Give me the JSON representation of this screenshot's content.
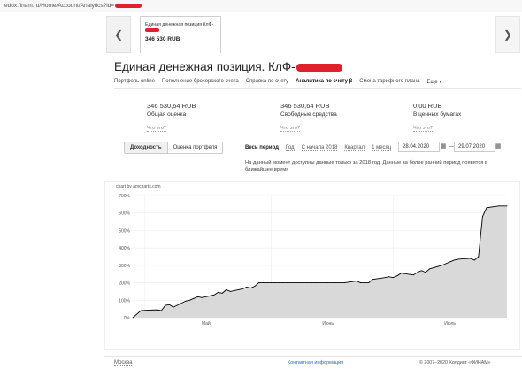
{
  "browser": {
    "url": "edox.finam.ru/Home/Account/Analytics?id="
  },
  "carousel": {
    "prev_icon": "chevron-left-icon",
    "next_icon": "chevron-right-icon",
    "card": {
      "name": "Единая денежная позиция КлФ-",
      "value": "346 530 RUB"
    }
  },
  "page": {
    "title": "Единая денежная позиция. КлФ-"
  },
  "tabs": [
    {
      "label": "Портфель online",
      "active": false
    },
    {
      "label": "Пополнение брокерского счета",
      "active": false
    },
    {
      "label": "Справка по счету",
      "active": false
    },
    {
      "label": "Аналитика по счету β",
      "active": true
    },
    {
      "label": "Смена тарифного плана",
      "active": false
    },
    {
      "label": "Еще ▾",
      "active": false
    }
  ],
  "metrics": [
    {
      "value": "346 530,64 RUB",
      "label": "Общая оценка",
      "help": "Что это?"
    },
    {
      "value": "346 530,64 RUB",
      "label": "Свободные средства",
      "help": "Что это?"
    },
    {
      "value": "0,00 RUB",
      "label": "В ценных бумагах",
      "help": "Что это?"
    }
  ],
  "view_toggle": {
    "yield_label": "Доходность",
    "portfolio_label": "Оценка портфеля"
  },
  "period": {
    "label": "Весь период",
    "links": [
      "Год",
      "С начала 2018",
      "Квартал",
      "1 месяц"
    ],
    "date_from": "28.04.2020",
    "date_to": "29.07.2020",
    "separator": "—"
  },
  "note": "На данный момент доступны данные только за 2018 год. Данные за более ранний период появятся в ближайшее время",
  "chart_credit": "chart by amcharts.com",
  "chart_data": {
    "type": "area",
    "title": "",
    "xlabel": "",
    "ylabel": "",
    "y_ticks": [
      "0%",
      "100%",
      "200%",
      "300%",
      "400%",
      "500%",
      "600%",
      "700%"
    ],
    "x_ticks": [
      "Май",
      "Июнь",
      "Июль"
    ],
    "ylim": [
      0,
      700
    ],
    "grid": true,
    "color": "#000000",
    "fill": "#d9d9d9",
    "x": [
      "2020-04-28",
      "2020-04-29",
      "2020-04-30",
      "2020-05-01",
      "2020-05-04",
      "2020-05-05",
      "2020-05-06",
      "2020-05-07",
      "2020-05-08",
      "2020-05-11",
      "2020-05-12",
      "2020-05-13",
      "2020-05-14",
      "2020-05-15",
      "2020-05-18",
      "2020-05-19",
      "2020-05-20",
      "2020-05-21",
      "2020-05-22",
      "2020-05-25",
      "2020-05-26",
      "2020-05-27",
      "2020-05-28",
      "2020-05-29",
      "2020-06-01",
      "2020-06-02",
      "2020-06-03",
      "2020-06-04",
      "2020-06-05",
      "2020-06-08",
      "2020-06-09",
      "2020-06-10",
      "2020-06-11",
      "2020-06-12",
      "2020-06-15",
      "2020-06-16",
      "2020-06-17",
      "2020-06-18",
      "2020-06-19",
      "2020-06-22",
      "2020-06-23",
      "2020-06-24",
      "2020-06-25",
      "2020-06-26",
      "2020-06-29",
      "2020-06-30",
      "2020-07-01",
      "2020-07-02",
      "2020-07-03",
      "2020-07-06",
      "2020-07-07",
      "2020-07-08",
      "2020-07-09",
      "2020-07-10",
      "2020-07-13",
      "2020-07-14",
      "2020-07-15",
      "2020-07-16",
      "2020-07-17",
      "2020-07-20",
      "2020-07-21",
      "2020-07-22",
      "2020-07-23",
      "2020-07-24",
      "2020-07-27",
      "2020-07-28",
      "2020-07-29"
    ],
    "values": [
      0,
      20,
      40,
      42,
      45,
      40,
      70,
      75,
      60,
      95,
      100,
      110,
      120,
      115,
      130,
      145,
      140,
      160,
      150,
      165,
      175,
      170,
      180,
      200,
      200,
      200,
      200,
      200,
      200,
      200,
      200,
      200,
      200,
      200,
      200,
      200,
      200,
      200,
      200,
      210,
      200,
      200,
      200,
      220,
      230,
      235,
      230,
      240,
      255,
      245,
      260,
      270,
      260,
      280,
      300,
      310,
      320,
      330,
      335,
      340,
      330,
      350,
      580,
      630,
      640,
      640,
      640
    ]
  },
  "footer": {
    "city": "Москва",
    "contact": "Контактная информация",
    "copyright": "© 2007–2020 Холдинг «ФИНАМ»"
  }
}
